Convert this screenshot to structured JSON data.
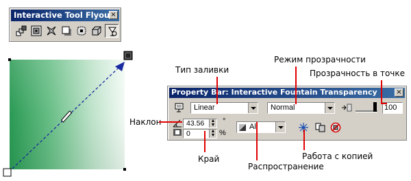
{
  "flyout": {
    "title": "Interactive Tool Flyout",
    "close": "×",
    "tools": [
      {
        "icon": "interactive-blend-icon"
      },
      {
        "icon": "interactive-contour-icon"
      },
      {
        "icon": "interactive-distortion-icon"
      },
      {
        "icon": "interactive-drop-shadow-icon"
      },
      {
        "icon": "interactive-envelope-icon"
      },
      {
        "icon": "interactive-extrude-icon"
      },
      {
        "icon": "interactive-transparency-icon"
      }
    ]
  },
  "property_bar": {
    "title": "Property Bar: Interactive Fountain Transparency",
    "close": "×",
    "fill_type": "Linear",
    "transparency_mode": "Normal",
    "transparency_value": "100",
    "angle_value": "43.56",
    "angle_unit": "°",
    "edge_pad_value": "0",
    "edge_pad_unit": "%",
    "apply_to_value": "All"
  },
  "annotations": {
    "fill_type": "Тип заливки",
    "transparency_mode": "Режим прозрачности",
    "node_transparency": "Прозрачность в точке",
    "angle": "Наклон",
    "edge": "Край",
    "apply_to": "Распространение",
    "copy": "Работа с копией"
  }
}
